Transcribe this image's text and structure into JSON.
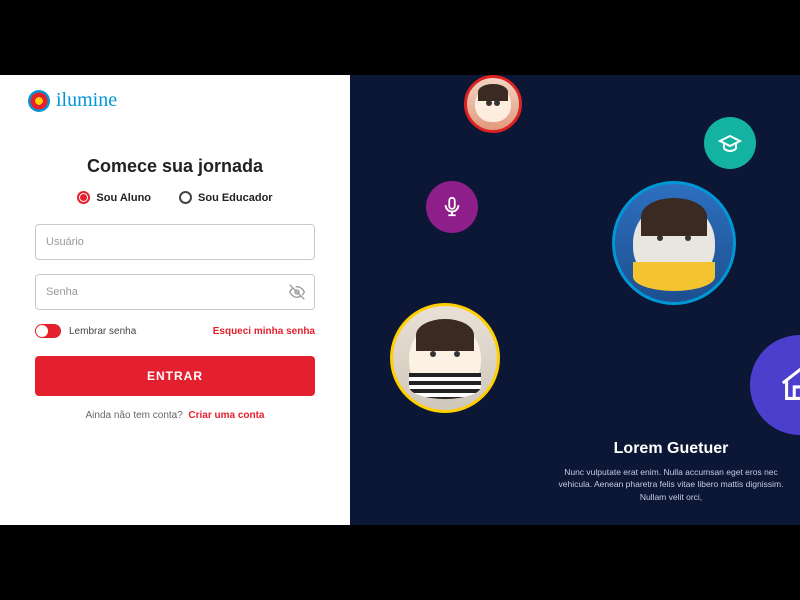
{
  "brand": {
    "name": "ilumine"
  },
  "login": {
    "headline": "Comece sua jornada",
    "roles": {
      "student": "Sou Aluno",
      "educator": "Sou Educador"
    },
    "username_placeholder": "Usuário",
    "password_placeholder": "Senha",
    "remember_label": "Lembrar senha",
    "forgot_label": "Esqueci minha senha",
    "submit_label": "ENTRAR",
    "signup_prompt": "Ainda não tem conta?",
    "signup_action": "Criar uma conta"
  },
  "promo": {
    "title": "Lorem Guetuer",
    "body": "Nunc vulputate erat enim. Nulla accumsan eget eros nec vehicula. Aenean pharetra felis vitae libero mattis dignissim. Nullam velit orci,"
  }
}
